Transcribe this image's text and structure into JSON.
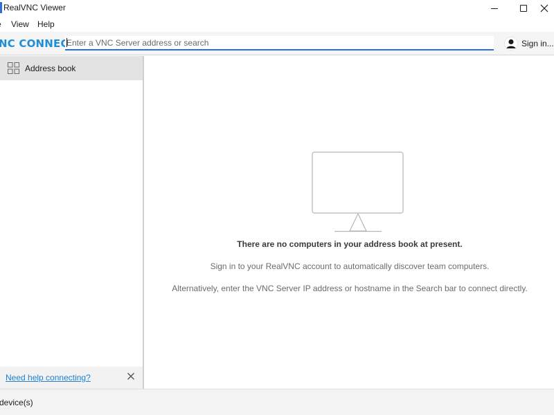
{
  "window": {
    "title": "RealVNC Viewer",
    "controls": [
      "minimize-icon",
      "maximize-icon",
      "close-icon"
    ]
  },
  "menu": {
    "items": [
      {
        "label": "e"
      },
      {
        "label": "View"
      },
      {
        "label": "Help"
      }
    ]
  },
  "toolbar": {
    "brand": "NC CONNECT",
    "search_placeholder": "Enter a VNC Server address or search",
    "search_value": "",
    "sign_in_label": "Sign in..."
  },
  "sidebar": {
    "items": [
      {
        "label": "Address book",
        "icon": "grid-icon",
        "selected": true
      }
    ],
    "help_link": "Need help connecting?"
  },
  "main": {
    "empty_title": "There are no computers in your address book at present.",
    "empty_line1": "Sign in to your RealVNC account to automatically discover team computers.",
    "empty_line2": "Alternatively, enter the VNC Server IP address or hostname in the Search bar to connect directly."
  },
  "status": {
    "text": "device(s)"
  },
  "colors": {
    "accent": "#2a6fdb",
    "brand": "#1e8fd6",
    "link": "#1e7fd0"
  }
}
